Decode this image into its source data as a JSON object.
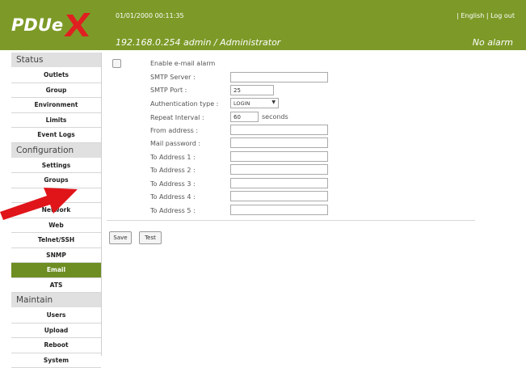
{
  "header": {
    "logo_text": "PDUeX",
    "datetime": "01/01/2000 00:11:35",
    "lang_link": "English",
    "separator": "|",
    "logout_link": "Log out",
    "ip_user": "192.168.0.254  admin / Administrator",
    "alarm_status": "No alarm"
  },
  "sidebar": {
    "status_title": "Status",
    "status_items": [
      "Outlets",
      "Group",
      "Environment",
      "Limits",
      "Event Logs"
    ],
    "config_title": "Configuration",
    "config_items": [
      "Settings",
      "Groups",
      "N",
      "Network",
      "Web",
      "Telnet/SSH",
      "SNMP",
      "Email",
      "ATS"
    ],
    "maintain_title": "Maintain",
    "maintain_items": [
      "Users",
      "Upload",
      "Reboot",
      "System"
    ]
  },
  "form": {
    "enable_label": "Enable e-mail alarm",
    "smtp_server_label": "SMTP Server :",
    "smtp_server_value": "",
    "smtp_port_label": "SMTP Port :",
    "smtp_port_value": "25",
    "auth_label": "Authentication type :",
    "auth_value": "LOGIN",
    "repeat_label": "Repeat Interval :",
    "repeat_value": "60",
    "repeat_unit": "seconds",
    "from_label": "From address :",
    "password_label": "Mail password :",
    "to1_label": "To Address 1 :",
    "to2_label": "To Address 2 :",
    "to3_label": "To Address 3 :",
    "to4_label": "To Address 4 :",
    "to5_label": "To Address 5 :",
    "save_label": "Save",
    "test_label": "Test"
  },
  "colors": {
    "header_green": "#7d9a28",
    "active_green": "#6e8d22",
    "logo_red": "#e02020",
    "arrow_red": "#e0151a"
  }
}
